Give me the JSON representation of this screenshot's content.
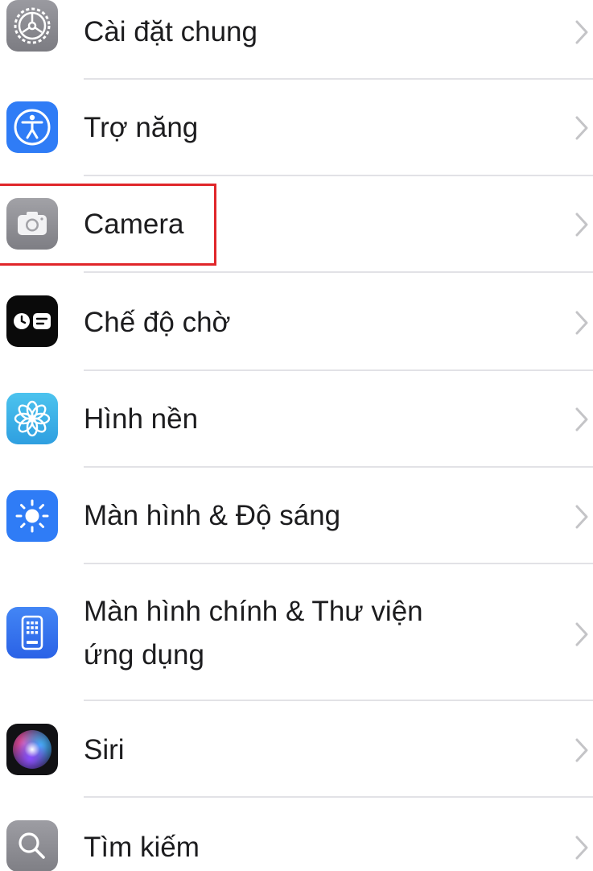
{
  "settings": {
    "items": [
      {
        "label": "Cài đặt chung",
        "icon": "gear-icon",
        "color": "#8e8e93"
      },
      {
        "label": "Trợ năng",
        "icon": "accessibility-icon",
        "color": "#2f7cf6"
      },
      {
        "label": "Camera",
        "icon": "camera-icon",
        "color": "#8e8e93"
      },
      {
        "label": "Chế độ chờ",
        "icon": "standby-icon",
        "color": "#000000"
      },
      {
        "label": "Hình nền",
        "icon": "wallpaper-flower-icon",
        "color": "#3db5e6"
      },
      {
        "label": "Màn hình & Độ sáng",
        "icon": "brightness-sun-icon",
        "color": "#2f7cf6"
      },
      {
        "label_line1": "Màn hình chính & Thư viện",
        "label_line2": "ứng dụng",
        "icon": "home-screen-icon",
        "color": "#2f6ef0"
      },
      {
        "label": "Siri",
        "icon": "siri-icon",
        "color": "#1a1a1a"
      },
      {
        "label": "Tìm kiếm",
        "icon": "search-icon",
        "color": "#8e8e93"
      }
    ],
    "highlight_color": "#e0262a"
  }
}
